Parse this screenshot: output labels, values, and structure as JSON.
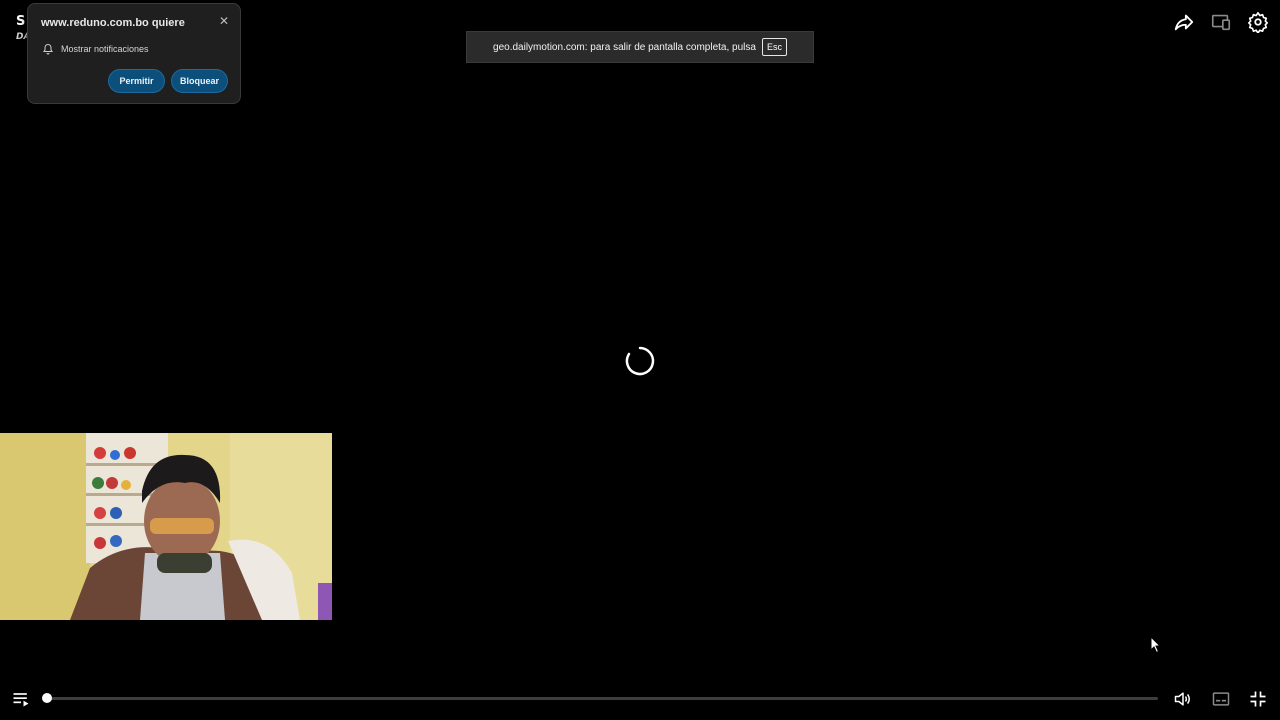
{
  "video": {
    "title_partial": "S",
    "subtitle_partial": "DA",
    "loading": true
  },
  "notification_popup": {
    "site": "www.reduno.com.bo quiere",
    "permission_label": "Mostrar notificaciones",
    "allow_label": "Permitir",
    "block_label": "Bloquear",
    "close_glyph": "✕",
    "icon": "bell-icon"
  },
  "fullscreen_toast": {
    "text": "geo.dailymotion.com: para salir de pantalla completa, pulsa",
    "key": "Esc"
  },
  "top_controls": [
    {
      "name": "share-icon"
    },
    {
      "name": "cast-icon"
    },
    {
      "name": "settings-icon"
    }
  ],
  "bottom_controls": {
    "left": [
      "playlist-play-icon"
    ],
    "right": [
      "volume-icon",
      "subtitles-icon",
      "exit-fullscreen-icon"
    ],
    "progress_fraction": 0.0
  },
  "colors": {
    "background": "#000000",
    "popup_bg": "#1f1f1f",
    "button_bg": "#0b4f7a",
    "toast_bg": "#2b2b2b",
    "progress_track": "#3d3d3d",
    "progress_fill": "#ffffff"
  }
}
